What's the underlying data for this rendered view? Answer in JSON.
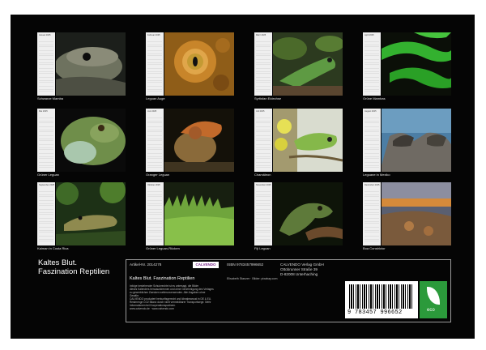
{
  "title": {
    "line1": "Kaltes Blut.",
    "line2": "Faszination Reptilien"
  },
  "months": [
    {
      "month": "Januar 2025",
      "caption": "Schwarze Mamba"
    },
    {
      "month": "Februar 2025",
      "caption": "Leguan Auge"
    },
    {
      "month": "März 2025",
      "caption": "Syrtisfan Eidechse"
    },
    {
      "month": "April 2025",
      "caption": "Grüne Mambas"
    },
    {
      "month": "Mai 2025",
      "caption": "Grüner Leguan"
    },
    {
      "month": "Juni 2025",
      "caption": "Oranger Leguan"
    },
    {
      "month": "Juli 2025",
      "caption": "Chamäleon"
    },
    {
      "month": "August 2025",
      "caption": "Leguane in Mexiko"
    },
    {
      "month": "September 2025",
      "caption": "Kaiman in Costa Rica"
    },
    {
      "month": "Oktober 2025",
      "caption": "Grüner Leguan-Rücken"
    },
    {
      "month": "November 2025",
      "caption": "Fiji Leguan"
    },
    {
      "month": "Dezember 2025",
      "caption": "Boa Constrictor"
    }
  ],
  "imprint": {
    "article": "Artikel-Nr. 2014278",
    "logo": "CALVENDO",
    "product_title": "Kaltes Blut. Faszination Reptilien",
    "isbn": "ISBN 9783457996652",
    "publisher": [
      "CALVENDO Verlag GmbH",
      "Ottobrunner Straße 39",
      "D-82008 Unterhaching"
    ],
    "author": "Elisabeth Stanzer · Bilder: pixabay.com",
    "small_text": [
      "Infolge bestehender Schutzrechte ist es untersagt, die Bilder",
      "dieses Kalenders herauszutrennen und ohne Genehmigung des Verlages",
      "zu gewerblichen Zwecken weiterzuverwenden. Alle Angaben ohne",
      "Gewähr.",
      "CALVENDO produziert herkunftsgerecht und klimabewusst in DE & EU.",
      "Restmenge CO2 Bilanz durch nicht vermeidbarer Transportwege. Mehr",
      "Informationen bei Kooperationspartnern.",
      "www.calvendo.de · www.calvendo.com"
    ],
    "barcode_number": "9 783457 996652",
    "eco_label": "eco"
  },
  "colors": {
    "page_bg": "#050505",
    "eco_green": "#2b9a3b"
  }
}
